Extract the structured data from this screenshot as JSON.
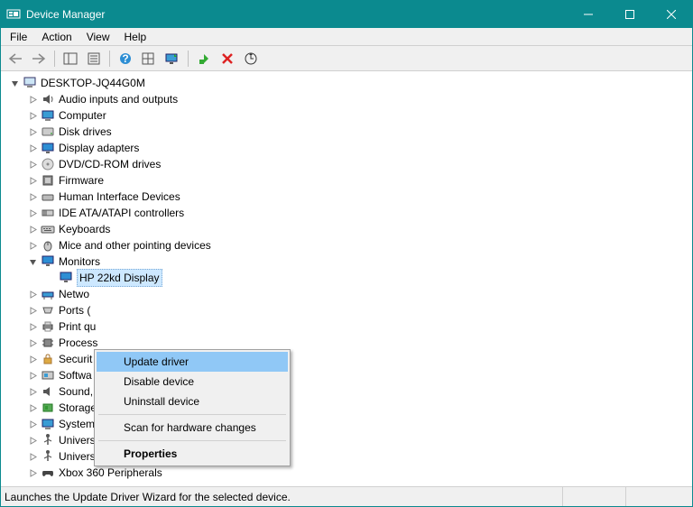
{
  "window": {
    "title": "Device Manager"
  },
  "menubar": {
    "file": "File",
    "action": "Action",
    "view": "View",
    "help": "Help"
  },
  "tree": {
    "root": "DESKTOP-JQ44G0M",
    "categories": {
      "audio": "Audio inputs and outputs",
      "computer": "Computer",
      "disk": "Disk drives",
      "display": "Display adapters",
      "dvd": "DVD/CD-ROM drives",
      "firmware": "Firmware",
      "hid": "Human Interface Devices",
      "ide": "IDE ATA/ATAPI controllers",
      "keyboards": "Keyboards",
      "mice": "Mice and other pointing devices",
      "monitors": "Monitors",
      "monitor_item": "HP 22kd Display",
      "network": "Network adapters",
      "ports": "Ports (COM & LPT)",
      "print": "Print queues",
      "processors": "Processors",
      "security": "Security devices",
      "software": "Software devices",
      "sound": "Sound, video and game controllers",
      "storage": "Storage controllers",
      "system": "System devices",
      "usb_ctrl": "Universal Serial Bus controllers",
      "usb_dev": "Universal Serial Bus devices",
      "xbox": "Xbox 360 Peripherals"
    },
    "categories_truncated": {
      "network": "Netwo",
      "ports": "Ports (",
      "print": "Print qu",
      "processors": "Process",
      "security": "Securit",
      "software": "Softwa",
      "sound": "Sound,"
    }
  },
  "context_menu": {
    "update": "Update driver",
    "disable": "Disable device",
    "uninstall": "Uninstall device",
    "scan": "Scan for hardware changes",
    "properties": "Properties"
  },
  "statusbar": {
    "text": "Launches the Update Driver Wizard for the selected device."
  }
}
